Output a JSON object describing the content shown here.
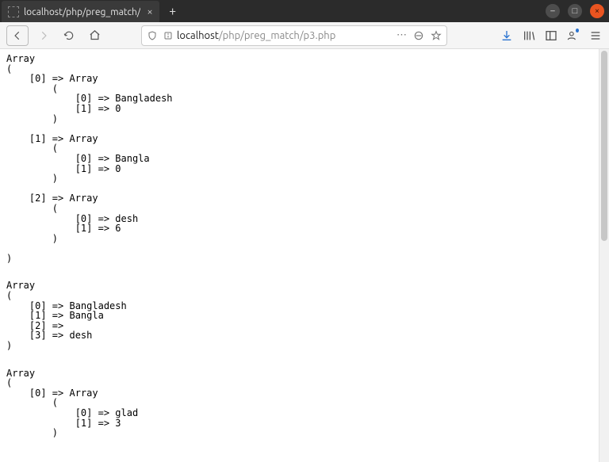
{
  "window": {
    "tab_title": "localhost/php/preg_match/",
    "minimize_glyph": "–",
    "maximize_glyph": "□",
    "close_glyph": "×",
    "newtab_glyph": "+"
  },
  "nav": {
    "url_host": "localhost",
    "url_path": "/php/preg_match/p3.php",
    "ellipsis": "⋯"
  },
  "output": {
    "arrays": [
      {
        "header": "Array",
        "entries": [
          {
            "index": "0",
            "type": "Array",
            "sub": [
              {
                "k": "0",
                "v": "Bangladesh"
              },
              {
                "k": "1",
                "v": "0"
              }
            ]
          },
          {
            "index": "1",
            "type": "Array",
            "sub": [
              {
                "k": "0",
                "v": "Bangla"
              },
              {
                "k": "1",
                "v": "0"
              }
            ]
          },
          {
            "index": "2",
            "type": "Array",
            "sub": [
              {
                "k": "0",
                "v": "desh"
              },
              {
                "k": "1",
                "v": "6"
              }
            ]
          }
        ]
      },
      {
        "header": "Array",
        "flat": [
          {
            "k": "0",
            "v": "Bangladesh"
          },
          {
            "k": "1",
            "v": "Bangla"
          },
          {
            "k": "2",
            "v": ""
          },
          {
            "k": "3",
            "v": "desh"
          }
        ]
      },
      {
        "header": "Array",
        "entries": [
          {
            "index": "0",
            "type": "Array",
            "sub": [
              {
                "k": "0",
                "v": "glad"
              },
              {
                "k": "1",
                "v": "3"
              }
            ]
          }
        ],
        "truncated_after": true
      }
    ]
  }
}
